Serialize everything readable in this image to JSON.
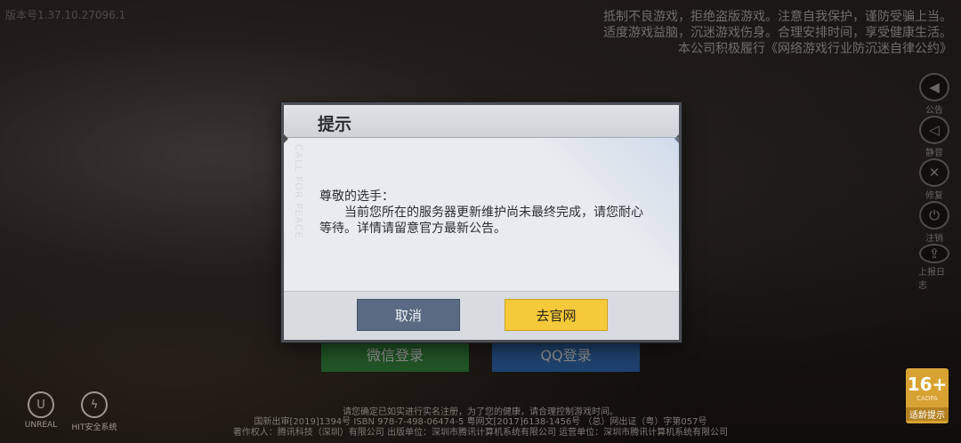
{
  "version": "版本号1.37.10.27096.1",
  "notice": {
    "line1": "抵制不良游戏，拒绝盗版游戏。注意自我保护，谨防受骗上当。",
    "line2": "适度游戏益脑，沉迷游戏伤身。合理安排时间，享受健康生活。",
    "line3": "本公司积极履行《网络游戏行业防沉迷自律公约》"
  },
  "rail": [
    {
      "label": "公告",
      "icon": "megaphone-icon",
      "glyph": "📢"
    },
    {
      "label": "静音",
      "icon": "speaker-icon",
      "glyph": "🔊"
    },
    {
      "label": "修复",
      "icon": "tools-icon",
      "glyph": "✕"
    },
    {
      "label": "注销",
      "icon": "power-icon",
      "glyph": "⏻"
    },
    {
      "label": "上报日志",
      "icon": "upload-icon",
      "glyph": "⇪"
    }
  ],
  "login": {
    "wechat": "微信登录",
    "qq": "QQ登录"
  },
  "footer": {
    "line1": "请您确定已如实进行实名注册，为了您的健康，请合理控制游戏时间。",
    "line2": "国新出审[2019]1394号  ISBN 978-7-498-06474-5  粤网文[2017]6138-1456号 （总）网出证（粤）字第057号",
    "line3": "著作权人：腾讯科技（深圳）有限公司  出版单位：深圳市腾讯计算机系统有限公司  运营单位：深圳市腾讯计算机系统有限公司"
  },
  "logos": {
    "unreal": "UNREAL",
    "hit": "HIT安全系统"
  },
  "age": {
    "rating": "16+",
    "small": "CADPA",
    "label": "适龄提示"
  },
  "dialog": {
    "title": "提示",
    "watermark": "CALL FOR PEACE",
    "greeting": "尊敬的选手：",
    "message": "当前您所在的服务器更新维护尚未最终完成，请您耐心等待。详情请留意官方最新公告。",
    "cancel_label": "取消",
    "official_label": "去官网"
  },
  "colors": {
    "cancel": "#5a6a82",
    "confirm": "#f4c93a",
    "wechat": "#3d9a45",
    "qq": "#3779c9"
  }
}
